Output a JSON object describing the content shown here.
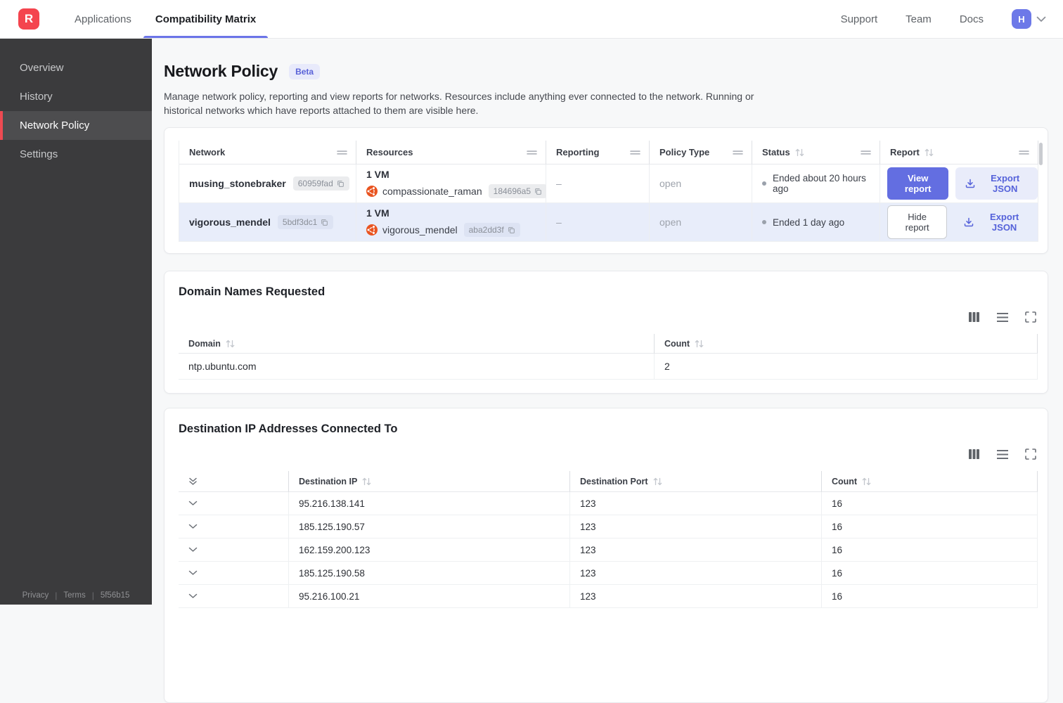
{
  "topnav": {
    "logo_letter": "R",
    "items": [
      {
        "label": "Applications"
      },
      {
        "label": "Compatibility Matrix"
      }
    ],
    "right_links": [
      "Support",
      "Team",
      "Docs"
    ],
    "avatar_letter": "H"
  },
  "sidebar": {
    "items": [
      {
        "label": "Overview"
      },
      {
        "label": "History"
      },
      {
        "label": "Network Policy"
      },
      {
        "label": "Settings"
      }
    ],
    "footer": {
      "privacy": "Privacy",
      "terms": "Terms",
      "build_id": "5f56b15"
    }
  },
  "page": {
    "title": "Network Policy",
    "badge": "Beta",
    "description": "Manage network policy, reporting and view reports for networks. Resources include anything ever connected to the network. Running or historical networks which have reports attached to them are visible here."
  },
  "networks_table": {
    "columns": [
      "Network",
      "Resources",
      "Reporting",
      "Policy Type",
      "Status",
      "Report"
    ],
    "rows": [
      {
        "network_name": "musing_stonebraker",
        "network_id": "60959fad",
        "resources_count": "1 VM",
        "resource_name": "compassionate_raman",
        "resource_id": "184696a5",
        "reporting": "–",
        "policy_type": "open",
        "status": "Ended about 20 hours ago",
        "report_button": "View report",
        "export_button": "Export JSON"
      },
      {
        "network_name": "vigorous_mendel",
        "network_id": "5bdf3dc1",
        "resources_count": "1 VM",
        "resource_name": "vigorous_mendel",
        "resource_id": "aba2dd3f",
        "reporting": "–",
        "policy_type": "open",
        "status": "Ended 1 day ago",
        "report_button": "Hide report",
        "export_button": "Export JSON"
      }
    ]
  },
  "domains": {
    "title": "Domain Names Requested",
    "columns": [
      "Domain",
      "Count"
    ],
    "rows": [
      {
        "domain": "ntp.ubuntu.com",
        "count": "2"
      }
    ]
  },
  "destinations": {
    "title": "Destination IP Addresses Connected To",
    "columns": [
      "Destination IP",
      "Destination Port",
      "Count"
    ],
    "rows": [
      {
        "ip": "95.216.138.141",
        "port": "123",
        "count": "16"
      },
      {
        "ip": "185.125.190.57",
        "port": "123",
        "count": "16"
      },
      {
        "ip": "162.159.200.123",
        "port": "123",
        "count": "16"
      },
      {
        "ip": "185.125.190.58",
        "port": "123",
        "count": "16"
      },
      {
        "ip": "95.216.100.21",
        "port": "123",
        "count": "16"
      }
    ]
  },
  "colors": {
    "accent_indigo": "#636ee1",
    "brand_red": "#f4444e",
    "ubuntu_orange": "#e95420",
    "selected_row": "#e8edfa",
    "sidebar_active_accent": "#ee4a52"
  }
}
